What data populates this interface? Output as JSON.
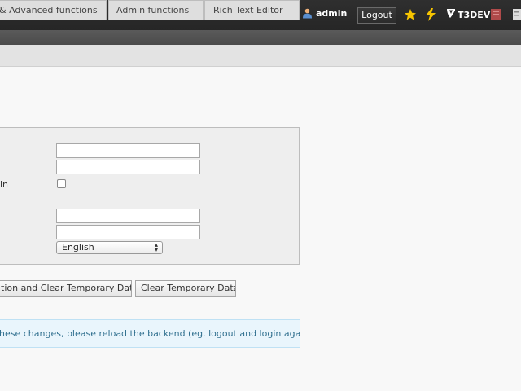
{
  "topbar": {
    "username": "admin",
    "logout_label": "Logout",
    "icons": [
      "user-icon",
      "bookmark-star-icon",
      "clear-cache-bolt-icon",
      "typo3-logo-icon",
      "help-book-icon",
      "search-icon"
    ],
    "system_name": "T3DEV",
    "colors": {
      "bar": "#2f2f2f",
      "star": "#f7c500",
      "bolt": "#f7c500"
    }
  },
  "tabs": [
    {
      "label": "& Advanced functions"
    },
    {
      "label": "Admin functions"
    },
    {
      "label": "Rich Text Editor"
    }
  ],
  "form": {
    "checkbox_label": "in",
    "language_select": {
      "value": "English"
    }
  },
  "buttons": {
    "save_clear_label": "tion and Clear Temporary Data",
    "clear_label": "Clear Temporary Data"
  },
  "info_message": "hese changes, please reload the backend (eg. logout and login again)."
}
